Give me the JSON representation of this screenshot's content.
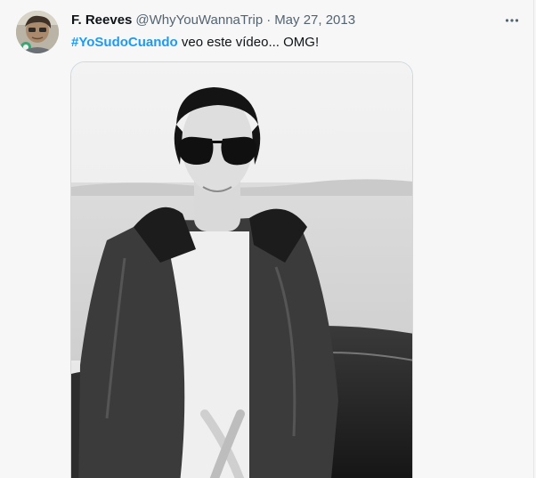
{
  "tweet": {
    "author": {
      "display_name": "F. Reeves",
      "handle": "@WhyYouWannaTrip"
    },
    "separator": "·",
    "date": "May 27, 2013",
    "text": {
      "hashtag": "#YoSudoCuando",
      "body": " veo este vídeo... OMG!"
    },
    "more_icon": "more-dots-icon",
    "media": {
      "kind": "photo",
      "description_style": "black-and-white"
    }
  },
  "colors": {
    "link": "#1d9bf0",
    "text_primary": "#0f1419",
    "text_secondary": "#536471",
    "border": "#cfd9de",
    "background": "#f7f7f7"
  }
}
